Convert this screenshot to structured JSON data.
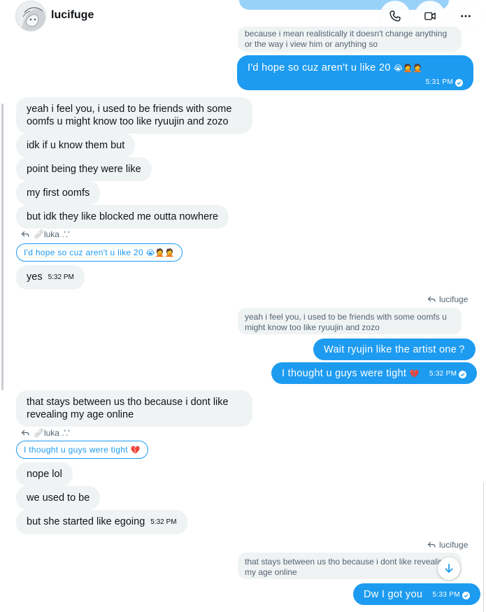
{
  "header": {
    "contact_name": "lucifuge",
    "avatar_icon": "avatar-icon",
    "call_icon": "phone-icon",
    "video_icon": "video-camera-icon",
    "more_icon": "more-horizontal-icon"
  },
  "colors": {
    "accent": "#1d9bf0",
    "incoming_bg": "#eff3f4",
    "muted_text": "#536471"
  },
  "messages": {
    "m0_quote": "because i mean realistically it doesn't change anything or the way i view him or anything so",
    "m1_text": "I'd hope so cuz aren't u like 20",
    "m1_emojis": "😭🤦🤦",
    "m1_time": "5:31 PM",
    "m2_text": "yeah i feel you, i used to be friends with some oomfs u might know too like ryuujin and zozo",
    "m3_text": "idk if u know them but",
    "m4_text": "point being they were like",
    "m5_text": "my first oomfs",
    "m6_text": "but idk they like blocked me outta nowhere",
    "r1_name": "🩹luka .'.'",
    "r1_quote": "I'd hope so cuz aren't u like 20",
    "r1_emojis": "😭🤦🤦",
    "m7_text": "yes",
    "m7_time": "5:32 PM",
    "r2_name": "lucifuge",
    "r2_quote": "yeah i feel you, i used to be friends with some oomfs u might know too like ryuujin and zozo",
    "m8_text": "Wait ryujin like the artist one ?",
    "m9_text": "I thought u guys were tight",
    "m9_emoji": "💔",
    "m9_time": "5:32 PM",
    "m10_text": "that stays between us tho because i dont like revealing my age online",
    "r3_name": "🩹luka .'.'",
    "r3_quote": "I thought u guys were tight",
    "r3_emoji": "💔",
    "m11_text": "nope lol",
    "m12_text": "we used to be",
    "m13_text": "but she started like egoing",
    "m13_time": "5:32 PM",
    "r4_name": "lucifuge",
    "r4_quote": "that stays between us tho because i dont like revealing my age online",
    "m14_text": "Dw I got you",
    "m14_time": "5:33 PM"
  },
  "scroll_down_icon": "arrow-down-icon"
}
